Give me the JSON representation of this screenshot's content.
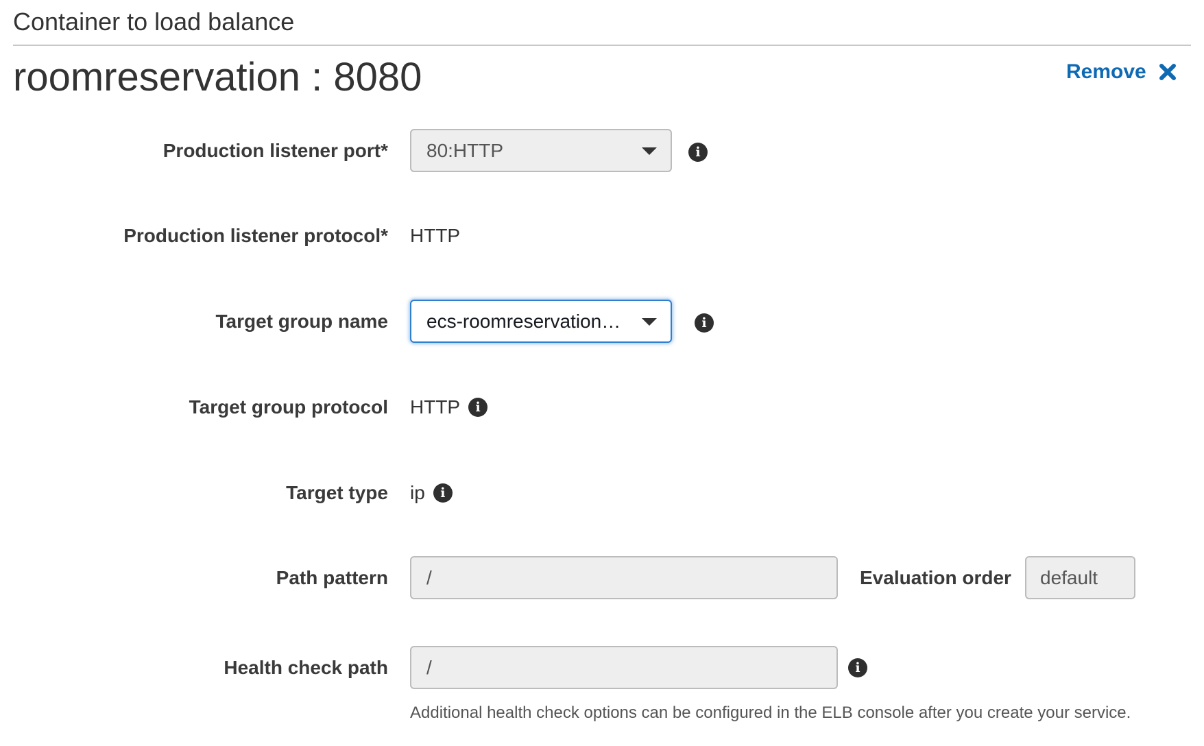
{
  "section": {
    "title": "Container to load balance"
  },
  "container": {
    "title": "roomreservation : 8080",
    "remove_label": "Remove"
  },
  "fields": {
    "production_listener_port": {
      "label": "Production listener port*",
      "value": "80:HTTP"
    },
    "production_listener_protocol": {
      "label": "Production listener protocol*",
      "value": "HTTP"
    },
    "target_group_name": {
      "label": "Target group name",
      "value": "ecs-roomreservation…"
    },
    "target_group_protocol": {
      "label": "Target group protocol",
      "value": "HTTP"
    },
    "target_type": {
      "label": "Target type",
      "value": "ip"
    },
    "path_pattern": {
      "label": "Path pattern",
      "value": "/"
    },
    "evaluation_order": {
      "label": "Evaluation order",
      "value": "default"
    },
    "health_check_path": {
      "label": "Health check path",
      "value": "/",
      "help_text": "Additional health check options can be configured in the ELB console after you create your service."
    }
  },
  "icons": {
    "info": "info-icon",
    "remove": "close-icon",
    "dropdown": "caret-down-icon"
  },
  "colors": {
    "link": "#0f6ab4",
    "focus_border": "#2f7fd1",
    "disabled_field_bg": "#eeeeee"
  }
}
